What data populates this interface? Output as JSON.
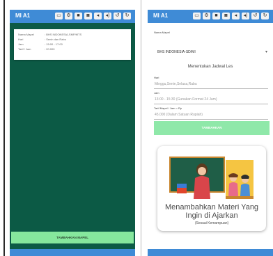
{
  "left_screen": {
    "app_title": "MI A1",
    "toolbar_icons": [
      "window-icon",
      "settings-icon",
      "camera-video-icon",
      "camera-icon",
      "volume-down-icon",
      "volume-up-icon",
      "rotate-left-icon",
      "rotate-right-icon"
    ],
    "info_card": {
      "rows": [
        {
          "key": "Nama Mapel",
          "value": ": BHS INDONESIA-SMP/MTS"
        },
        {
          "key": "Hari",
          "value": ": Senin dan Rabu"
        },
        {
          "key": "Jam",
          "value": ": 15:00 - 17:00"
        },
        {
          "key": "Tarif / Jam",
          "value": ": 20.000"
        }
      ]
    },
    "add_button_label": "TAMBAHKAN MAPEL"
  },
  "right_screen": {
    "app_title": "MI A1",
    "mapel_label": "Nama Mapel",
    "mapel_value": "BHS INDONESIA-SD/MI",
    "section_title": "Menentukan Jadwal Les",
    "fields": [
      {
        "label": "Hari",
        "placeholder": "Minggu,Senin,Selasa,Rabu"
      },
      {
        "label": "Jam",
        "placeholder": "13:00 - 15:30 (Gunakan Format 24 Jam)"
      },
      {
        "label": "Tarif Mapel / Jam = Rp",
        "placeholder": "45.000 (Dalam Satuan Rupiah)"
      }
    ],
    "add_button_label": "TAMBAHKAN",
    "promo": {
      "title_line1": "Menambahkan Materi Yang",
      "title_line2": "Ingin di Ajarkan",
      "subtitle": "(Sesuai Kemampuan)"
    }
  },
  "colors": {
    "appbar": "#3f8bd6",
    "left_background": "#0c5a45",
    "button_green": "#86e79d"
  }
}
